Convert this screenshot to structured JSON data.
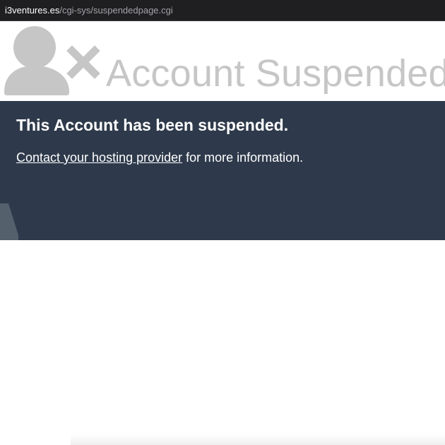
{
  "browser": {
    "url_host": "i3ventures.es",
    "url_path": "/cgi-sys/suspendedpage.cgi"
  },
  "header": {
    "icon": "user-x-icon",
    "title": "Account Suspended"
  },
  "banner": {
    "heading": "This Account has been suspended.",
    "link_text": "Contact your hosting provider",
    "text_suffix": " for more information."
  },
  "colors": {
    "url_bar_background": "#1f1f21",
    "header_text": "#c6c6c6",
    "icon": "#c6c6c6",
    "banner_background": "#2e3a4b",
    "banner_text": "#ffffff"
  }
}
